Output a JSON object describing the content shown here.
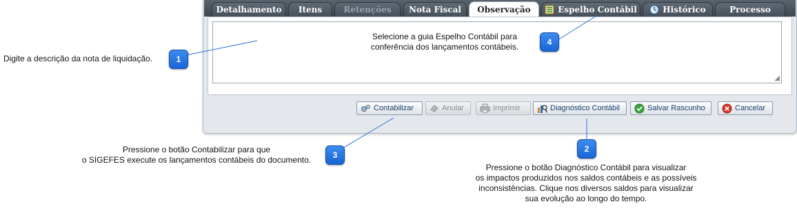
{
  "tabs": [
    {
      "label": "Detalhamento",
      "state": "normal"
    },
    {
      "label": "Itens",
      "state": "normal"
    },
    {
      "label": "Retenções",
      "state": "disabled"
    },
    {
      "label": "Nota Fiscal",
      "state": "normal"
    },
    {
      "label": "Observação",
      "state": "active"
    },
    {
      "label": "Espelho Contábil",
      "state": "normal",
      "icon": "ledger-icon"
    },
    {
      "label": "Histórico",
      "state": "normal",
      "icon": "history-icon"
    },
    {
      "label": "Processo",
      "state": "normal"
    }
  ],
  "buttons": {
    "contabilizar": "Contabilizar",
    "anular": "Anular",
    "imprimir": "Imprimir",
    "diagnostico": "Diagnóstico Contábil",
    "salvar": "Salvar Rascunho",
    "cancelar": "Cancelar"
  },
  "callouts": {
    "c1": {
      "number": "1",
      "text": "Digite a descrição da nota de liquidação."
    },
    "c2": {
      "number": "2",
      "line1": "Pressione o botão Diagnóstico Contábil para visualizar",
      "line2": "os impactos produzidos nos saldos contábeis e as possíveis",
      "line3": "inconsistências. Clique nos diversos saldos para visualizar",
      "line4": "sua evolução ao longo do tempo."
    },
    "c3": {
      "number": "3",
      "line1": "Pressione o botão Contabilizar para que",
      "line2": "o SIGEFES execute os lançamentos contábeis do documento."
    },
    "c4": {
      "number": "4",
      "line1": "Selecione a guia Espelho Contábil para",
      "line2": "conferência dos lançamentos contábeis."
    }
  },
  "colors": {
    "badge": "#1f75e0",
    "tabbar": "#4a535c",
    "accent_link": "#1a3c6a"
  }
}
